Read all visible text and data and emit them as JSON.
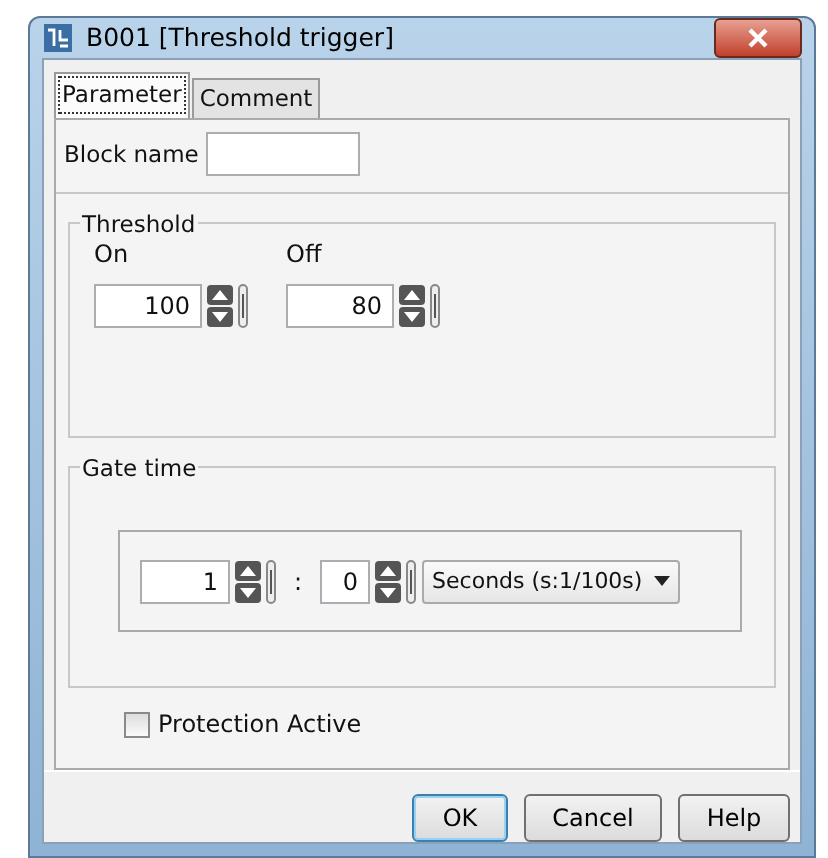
{
  "window": {
    "title": "B001 [Threshold trigger]"
  },
  "tabs": [
    {
      "label": "Parameter",
      "selected": true
    },
    {
      "label": "Comment",
      "selected": false
    }
  ],
  "block_name": {
    "label": "Block name"
  },
  "threshold": {
    "title": "Threshold",
    "fields": [
      {
        "label": "On",
        "value": "100"
      },
      {
        "label": "Off",
        "value": "80"
      }
    ]
  },
  "gate_time": {
    "title": "Gate time",
    "fields": [
      {
        "value": "1"
      },
      {
        "value": "0"
      }
    ],
    "separator": ":",
    "unit": "Seconds (s:1/100s)"
  },
  "protection": {
    "label": "Protection Active",
    "checked": false
  },
  "buttons": [
    {
      "label": "OK",
      "default": true
    },
    {
      "label": "Cancel",
      "default": false
    },
    {
      "label": "Help",
      "default": false
    }
  ]
}
